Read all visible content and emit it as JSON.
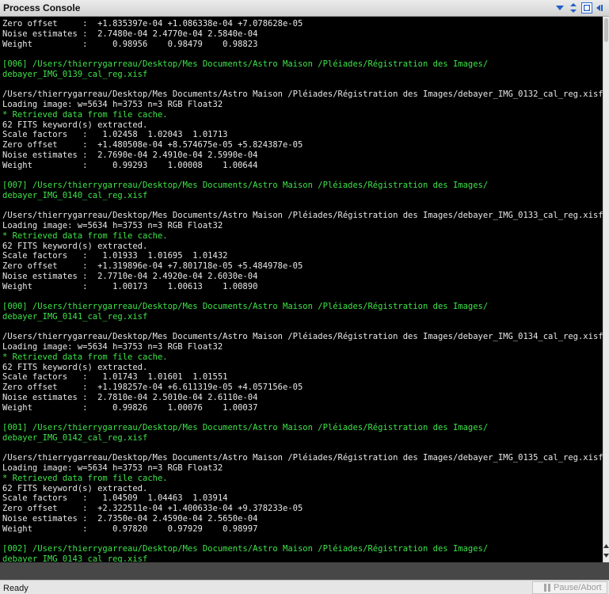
{
  "window": {
    "title": "Process Console"
  },
  "console": {
    "lines": [
      {
        "text": "Zero offset     :  +1.835397e-04 +1.086338e-04 +7.078628e-05",
        "color": "white"
      },
      {
        "text": "Noise estimates :  2.7480e-04 2.4770e-04 2.5840e-04",
        "color": "white"
      },
      {
        "text": "Weight          :     0.98956    0.98479    0.98823",
        "color": "white"
      },
      {
        "text": "",
        "color": "white"
      },
      {
        "text": "[006] /Users/thierrygarreau/Desktop/Mes Documents/Astro Maison /Pléiades/Régistration des Images/",
        "color": "green"
      },
      {
        "text": "debayer_IMG_0139_cal_reg.xisf",
        "color": "green"
      },
      {
        "text": "",
        "color": "white"
      },
      {
        "text": "/Users/thierrygarreau/Desktop/Mes Documents/Astro Maison /Pléiades/Régistration des Images/debayer_IMG_0132_cal_reg.xisf",
        "color": "white"
      },
      {
        "text": "Loading image: w=5634 h=3753 n=3 RGB Float32",
        "color": "white"
      },
      {
        "text": "* Retrieved data from file cache.",
        "color": "green"
      },
      {
        "text": "62 FITS keyword(s) extracted.",
        "color": "white"
      },
      {
        "text": "Scale factors   :   1.02458  1.02043  1.01713",
        "color": "white"
      },
      {
        "text": "Zero offset     :  +1.480508e-04 +8.574675e-05 +5.824387e-05",
        "color": "white"
      },
      {
        "text": "Noise estimates :  2.7690e-04 2.4910e-04 2.5990e-04",
        "color": "white"
      },
      {
        "text": "Weight          :     0.99293    1.00008    1.00644",
        "color": "white"
      },
      {
        "text": "",
        "color": "white"
      },
      {
        "text": "[007] /Users/thierrygarreau/Desktop/Mes Documents/Astro Maison /Pléiades/Régistration des Images/",
        "color": "green"
      },
      {
        "text": "debayer_IMG_0140_cal_reg.xisf",
        "color": "green"
      },
      {
        "text": "",
        "color": "white"
      },
      {
        "text": "/Users/thierrygarreau/Desktop/Mes Documents/Astro Maison /Pléiades/Régistration des Images/debayer_IMG_0133_cal_reg.xisf",
        "color": "white"
      },
      {
        "text": "Loading image: w=5634 h=3753 n=3 RGB Float32",
        "color": "white"
      },
      {
        "text": "* Retrieved data from file cache.",
        "color": "green"
      },
      {
        "text": "62 FITS keyword(s) extracted.",
        "color": "white"
      },
      {
        "text": "Scale factors   :   1.01933  1.01695  1.01432",
        "color": "white"
      },
      {
        "text": "Zero offset     :  +1.319896e-04 +7.801718e-05 +5.484978e-05",
        "color": "white"
      },
      {
        "text": "Noise estimates :  2.7710e-04 2.4920e-04 2.6030e-04",
        "color": "white"
      },
      {
        "text": "Weight          :     1.00173    1.00613    1.00890",
        "color": "white"
      },
      {
        "text": "",
        "color": "white"
      },
      {
        "text": "[000] /Users/thierrygarreau/Desktop/Mes Documents/Astro Maison /Pléiades/Régistration des Images/",
        "color": "green"
      },
      {
        "text": "debayer_IMG_0141_cal_reg.xisf",
        "color": "green"
      },
      {
        "text": "",
        "color": "white"
      },
      {
        "text": "/Users/thierrygarreau/Desktop/Mes Documents/Astro Maison /Pléiades/Régistration des Images/debayer_IMG_0134_cal_reg.xisf",
        "color": "white"
      },
      {
        "text": "Loading image: w=5634 h=3753 n=3 RGB Float32",
        "color": "white"
      },
      {
        "text": "* Retrieved data from file cache.",
        "color": "green"
      },
      {
        "text": "62 FITS keyword(s) extracted.",
        "color": "white"
      },
      {
        "text": "Scale factors   :   1.01743  1.01601  1.01551",
        "color": "white"
      },
      {
        "text": "Zero offset     :  +1.198257e-04 +6.611319e-05 +4.057156e-05",
        "color": "white"
      },
      {
        "text": "Noise estimates :  2.7810e-04 2.5010e-04 2.6110e-04",
        "color": "white"
      },
      {
        "text": "Weight          :     0.99826    1.00076    1.00037",
        "color": "white"
      },
      {
        "text": "",
        "color": "white"
      },
      {
        "text": "[001] /Users/thierrygarreau/Desktop/Mes Documents/Astro Maison /Pléiades/Régistration des Images/",
        "color": "green"
      },
      {
        "text": "debayer_IMG_0142_cal_reg.xisf",
        "color": "green"
      },
      {
        "text": "",
        "color": "white"
      },
      {
        "text": "/Users/thierrygarreau/Desktop/Mes Documents/Astro Maison /Pléiades/Régistration des Images/debayer_IMG_0135_cal_reg.xisf",
        "color": "white"
      },
      {
        "text": "Loading image: w=5634 h=3753 n=3 RGB Float32",
        "color": "white"
      },
      {
        "text": "* Retrieved data from file cache.",
        "color": "green"
      },
      {
        "text": "62 FITS keyword(s) extracted.",
        "color": "white"
      },
      {
        "text": "Scale factors   :   1.04509  1.04463  1.03914",
        "color": "white"
      },
      {
        "text": "Zero offset     :  +2.322511e-04 +1.400633e-04 +9.378233e-05",
        "color": "white"
      },
      {
        "text": "Noise estimates :  2.7350e-04 2.4590e-04 2.5650e-04",
        "color": "white"
      },
      {
        "text": "Weight          :     0.97820    0.97929    0.98997",
        "color": "white"
      },
      {
        "text": "",
        "color": "white"
      },
      {
        "text": "[002] /Users/thierrygarreau/Desktop/Mes Documents/Astro Maison /Pléiades/Régistration des Images/",
        "color": "green"
      },
      {
        "text": "debayer_IMG_0143_cal_reg.xisf",
        "color": "green"
      }
    ]
  },
  "status": {
    "text": "Ready",
    "pause_abort_label": "Pause/Abort"
  },
  "colors": {
    "console_background": "#000000",
    "console_text": "#e8e8e8",
    "console_highlight": "#3fe34a",
    "accent": "#2a6bd0"
  },
  "icons": {
    "title_controls": [
      "collapse-arrow-icon",
      "resize-vertical-icon",
      "float-window-icon",
      "dock-icon"
    ]
  }
}
